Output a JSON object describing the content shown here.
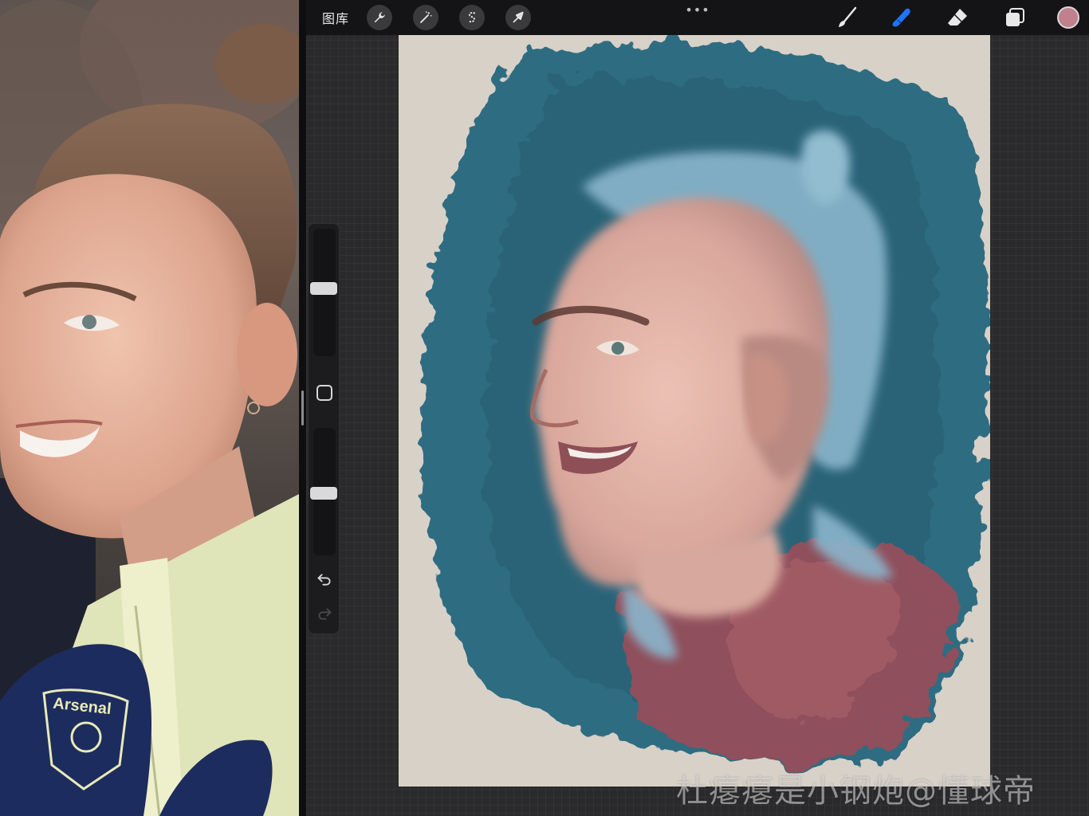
{
  "toolbar": {
    "gallery_label": "图库",
    "more_menu": "•••",
    "active_tool": "smudge",
    "current_color": "#c0808e",
    "icons": {
      "actions": "wrench-icon",
      "adjustments": "magic-wand-icon",
      "selection": "selection-s-icon",
      "transform": "arrow-cursor-icon",
      "brush": "brush-icon",
      "smudge": "smudge-finger-icon",
      "eraser": "eraser-icon",
      "layers": "layers-icon"
    }
  },
  "sidebar": {
    "brush_size": 0.6,
    "opacity": 0.45,
    "modify_icon": "square-icon",
    "undo_icon": "undo-icon",
    "redo_icon": "redo-icon"
  },
  "reference": {
    "jacket_logo_text": "Arsenal"
  },
  "watermark": "杜瘪瘪是小钢炮@懂球帝",
  "colors": {
    "toolbar_bg": "#141416",
    "workspace_bg": "#2a2a2c",
    "canvas_bg": "#d6cfc6",
    "active_accent": "#1f74ff",
    "paint_teal": "#2d6a80",
    "paint_pink": "#c39a94",
    "paint_lightblue": "#8ab6cc"
  }
}
